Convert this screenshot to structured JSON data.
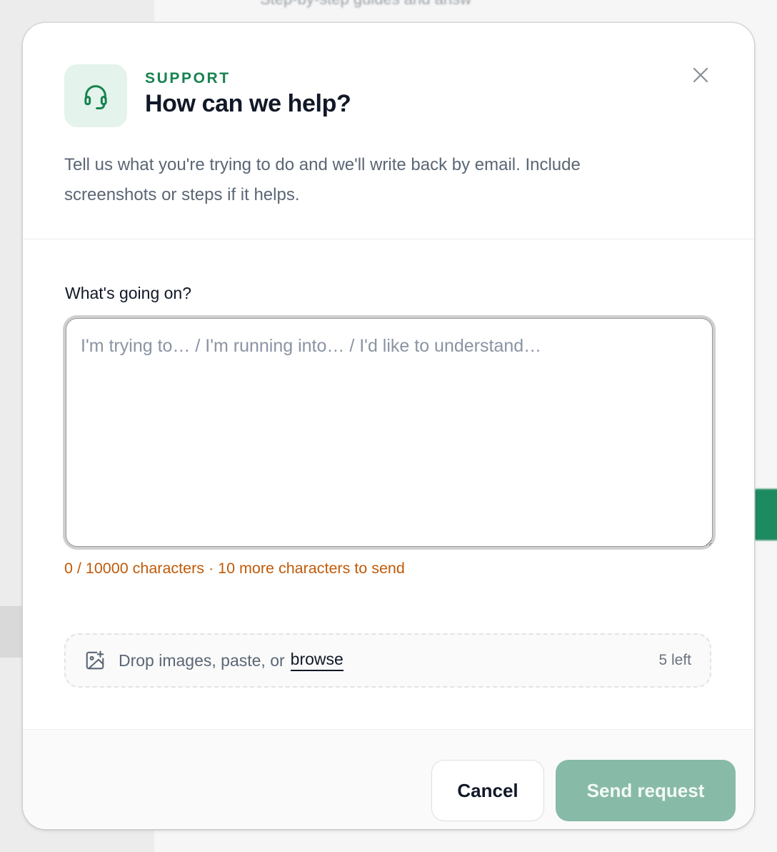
{
  "background": {
    "partial_text": "Step-by-step guides and answ"
  },
  "header": {
    "eyebrow": "SUPPORT",
    "title": "How can we help?",
    "description": "Tell us what you're trying to do and we'll write back by email. Include screenshots or steps if it helps.",
    "icon": "headset-icon",
    "close_icon": "close-icon"
  },
  "form": {
    "label": "What's going on?",
    "placeholder": "I'm trying to… / I'm running into… / I'd like to understand…",
    "value": "",
    "char_count": "0 / 10000 characters · 10 more characters to send",
    "dropzone": {
      "icon": "image-add-icon",
      "text": "Drop images, paste, or",
      "browse_label": "browse",
      "remaining": "5 left"
    }
  },
  "footer": {
    "cancel_label": "Cancel",
    "send_label": "Send request"
  },
  "colors": {
    "accent": "#17834f",
    "icon_tile": "#e4f3ec",
    "warning_text": "#c05a08",
    "send_disabled": "#88baa8"
  }
}
